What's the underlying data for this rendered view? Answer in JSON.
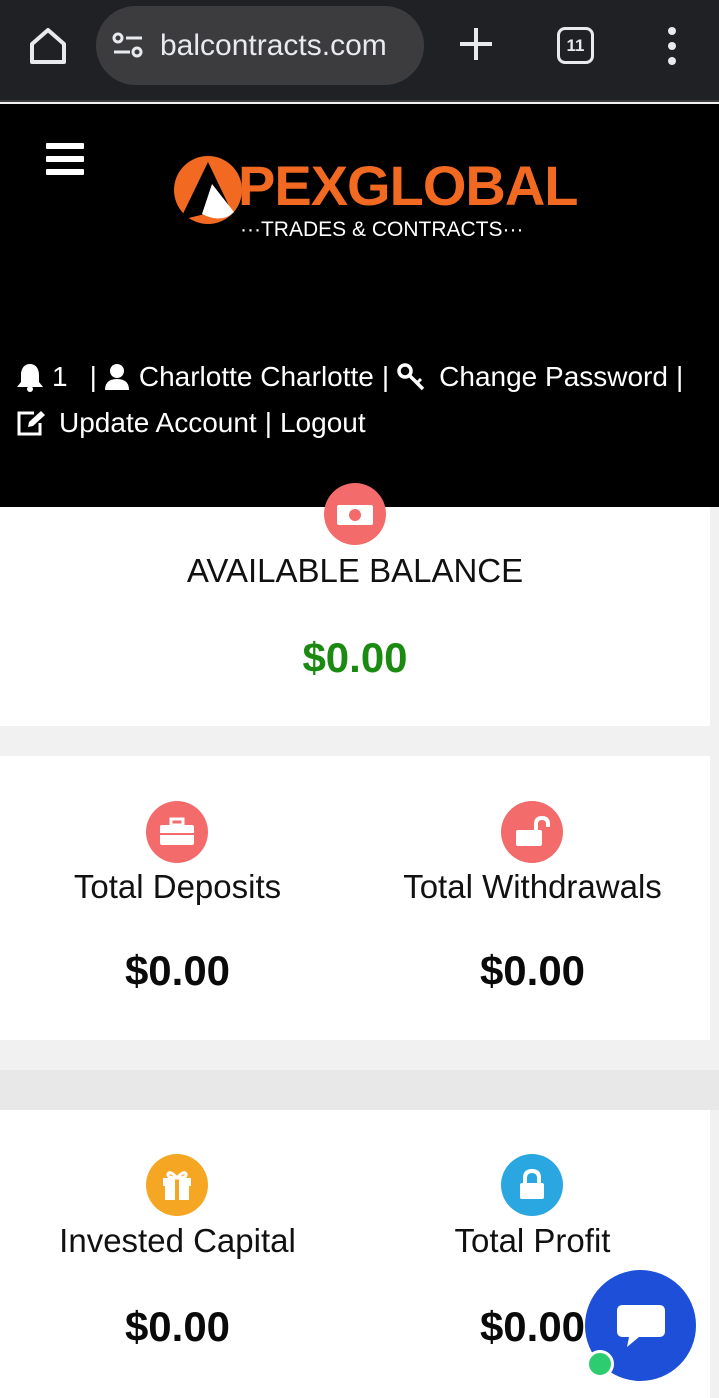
{
  "browser": {
    "url": "balcontracts.com",
    "tab_count": "11"
  },
  "header": {
    "logo_word": "PEXGLOBAL",
    "logo_sub": "···TRADES & CONTRACTS···",
    "notification_count": "1",
    "sep1": "|",
    "user_name": "Charlotte Charlotte",
    "sep2": "|",
    "change_password": "Change Password",
    "sep3": "|",
    "update_account": "Update Account",
    "sep4": "|",
    "logout": "Logout"
  },
  "balance": {
    "label": "AVAILABLE BALANCE",
    "value": "$0.00",
    "color": "#1b8a10"
  },
  "stats": [
    {
      "label": "Total Deposits",
      "value": "$0.00",
      "icon": "briefcase-icon",
      "color": "#f36b6b"
    },
    {
      "label": "Total Withdrawals",
      "value": "$0.00",
      "icon": "unlock-icon",
      "color": "#f36b6b"
    },
    {
      "label": "Invested Capital",
      "value": "$0.00",
      "icon": "gift-icon",
      "color": "#f5a623"
    },
    {
      "label": "Total Profit",
      "value": "$0.00",
      "icon": "lock-icon",
      "color": "#2aa7e0"
    }
  ]
}
